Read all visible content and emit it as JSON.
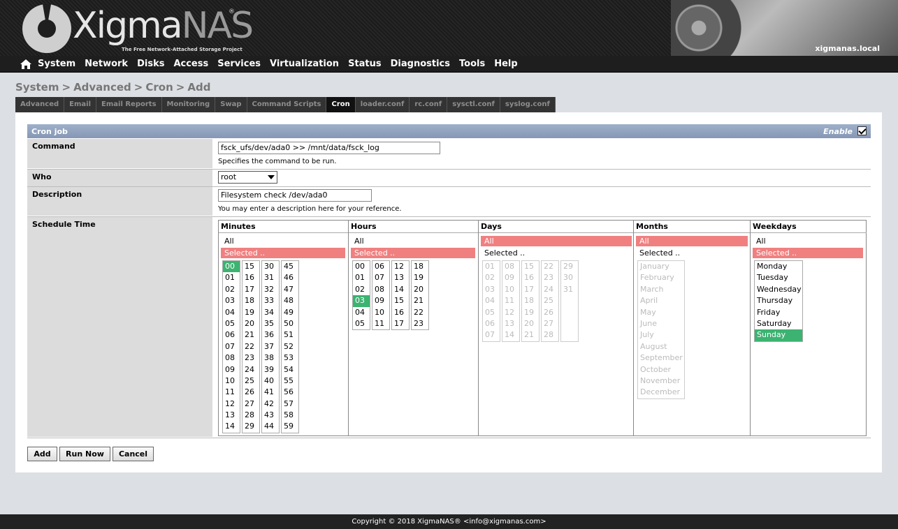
{
  "header": {
    "logo_main": "Xigma",
    "logo_accent": "NAS",
    "logo_registered": "®",
    "logo_tagline": "The Free Network-Attached Storage Project",
    "hostname": "xigmanas.local"
  },
  "nav": {
    "items": [
      "System",
      "Network",
      "Disks",
      "Access",
      "Services",
      "Virtualization",
      "Status",
      "Diagnostics",
      "Tools",
      "Help"
    ]
  },
  "breadcrumb": [
    "System",
    "Advanced",
    "Cron",
    "Add"
  ],
  "tabs": [
    "Advanced",
    "Email",
    "Email Reports",
    "Monitoring",
    "Swap",
    "Command Scripts",
    "Cron",
    "loader.conf",
    "rc.conf",
    "sysctl.conf",
    "syslog.conf"
  ],
  "active_tab": "Cron",
  "form": {
    "section_title": "Cron job",
    "enable_label": "Enable",
    "enable_checked": true,
    "command_label": "Command",
    "command_value": "fsck_ufs/dev/ada0 >> /mnt/data/fsck_log",
    "command_hint": "Specifies the command to be run.",
    "who_label": "Who",
    "who_value": "root",
    "description_label": "Description",
    "description_value": "Filesystem check /dev/ada0",
    "description_hint": "You may enter a description here for your reference.",
    "schedule_label": "Schedule Time"
  },
  "schedule": {
    "all_label": "All",
    "selected_label": "Selected ..",
    "minutes": {
      "title": "Minutes",
      "mode": "selected",
      "columns": [
        [
          "00",
          "01",
          "02",
          "03",
          "04",
          "05",
          "06",
          "07",
          "08",
          "09",
          "10",
          "11",
          "12",
          "13",
          "14"
        ],
        [
          "15",
          "16",
          "17",
          "18",
          "19",
          "20",
          "21",
          "22",
          "23",
          "24",
          "25",
          "26",
          "27",
          "28",
          "29"
        ],
        [
          "30",
          "31",
          "32",
          "33",
          "34",
          "35",
          "36",
          "37",
          "38",
          "39",
          "40",
          "41",
          "42",
          "43",
          "44"
        ],
        [
          "45",
          "46",
          "47",
          "48",
          "49",
          "50",
          "51",
          "52",
          "53",
          "54",
          "55",
          "56",
          "57",
          "58",
          "59"
        ]
      ],
      "selected": [
        "00"
      ]
    },
    "hours": {
      "title": "Hours",
      "mode": "selected",
      "columns": [
        [
          "00",
          "01",
          "02",
          "03",
          "04",
          "05"
        ],
        [
          "06",
          "07",
          "08",
          "09",
          "10",
          "11"
        ],
        [
          "12",
          "13",
          "14",
          "15",
          "16",
          "17"
        ],
        [
          "18",
          "19",
          "20",
          "21",
          "22",
          "23"
        ]
      ],
      "selected": [
        "03"
      ]
    },
    "days": {
      "title": "Days",
      "mode": "all",
      "columns": [
        [
          "01",
          "02",
          "03",
          "04",
          "05",
          "06",
          "07"
        ],
        [
          "08",
          "09",
          "10",
          "11",
          "12",
          "13",
          "14"
        ],
        [
          "15",
          "16",
          "17",
          "18",
          "19",
          "20",
          "21"
        ],
        [
          "22",
          "23",
          "24",
          "25",
          "26",
          "27",
          "28"
        ],
        [
          "29",
          "30",
          "31"
        ]
      ],
      "selected": []
    },
    "months": {
      "title": "Months",
      "mode": "all",
      "items": [
        "January",
        "February",
        "March",
        "April",
        "May",
        "June",
        "July",
        "August",
        "September",
        "October",
        "November",
        "December"
      ],
      "selected": []
    },
    "weekdays": {
      "title": "Weekdays",
      "mode": "selected",
      "items": [
        "Monday",
        "Tuesday",
        "Wednesday",
        "Thursday",
        "Friday",
        "Saturday",
        "Sunday"
      ],
      "selected": [
        "Sunday"
      ]
    }
  },
  "buttons": {
    "add": "Add",
    "run_now": "Run Now",
    "cancel": "Cancel"
  },
  "footer": {
    "copyright": "Copyright © 2018 XigmaNAS® <info@xigmanas.com>"
  },
  "colors": {
    "section_header": "#8fa2bf",
    "selected_mode": "#f08080",
    "selected_item": "#3cb371"
  }
}
